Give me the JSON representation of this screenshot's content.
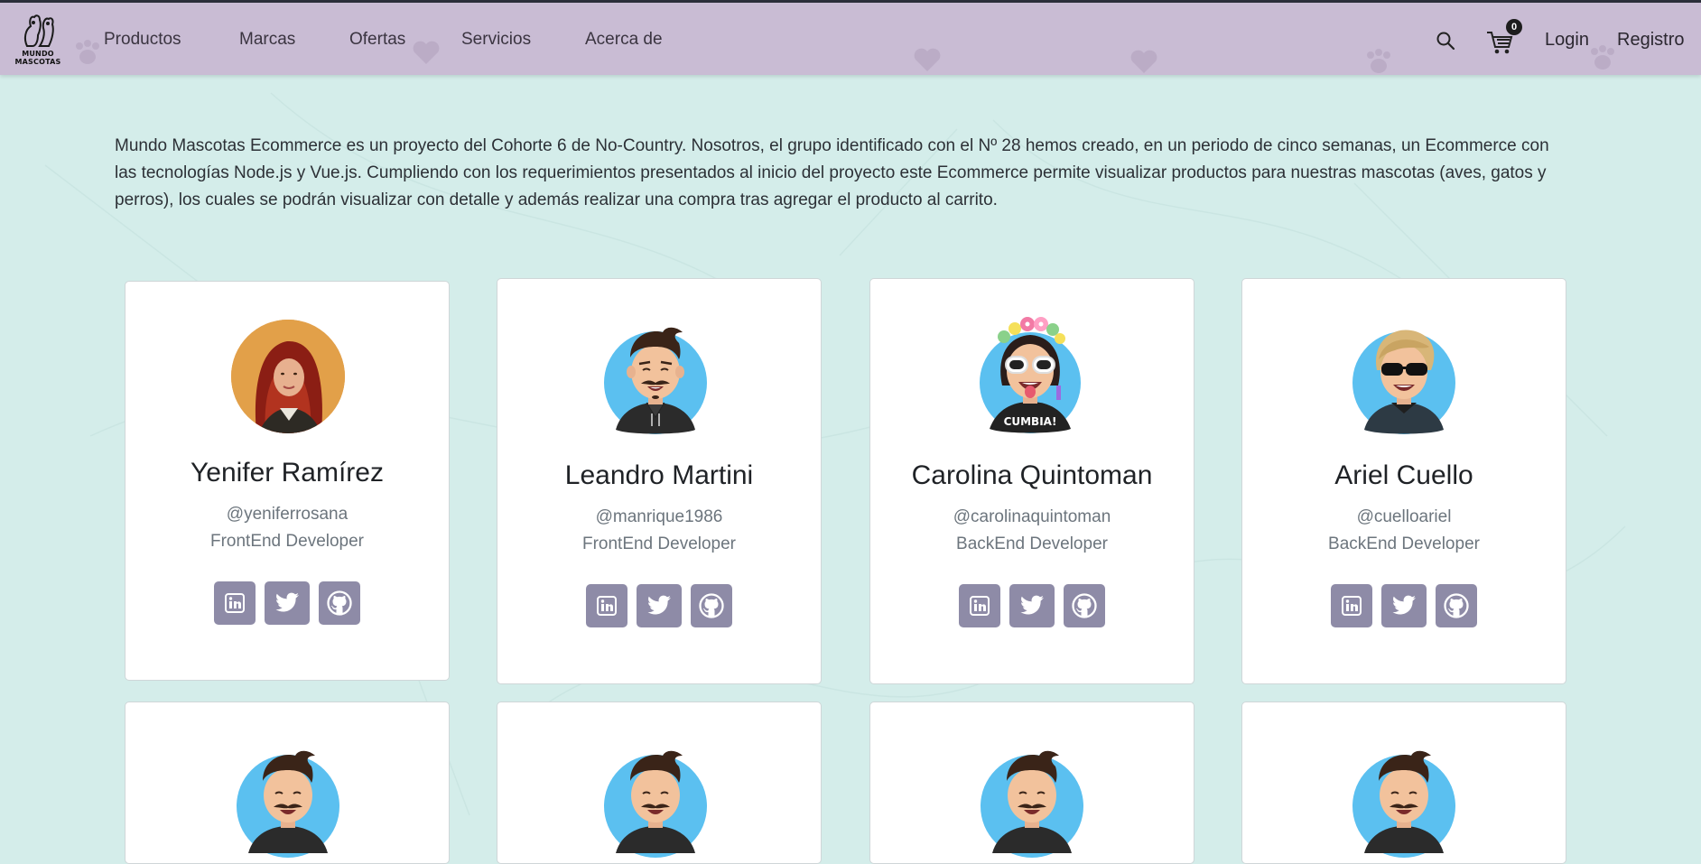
{
  "nav": {
    "logo_line1": "MUNDO",
    "logo_line2": "MASCOTAS",
    "links": [
      "Productos",
      "Marcas",
      "Ofertas",
      "Servicios",
      "Acerca de"
    ],
    "cart_count": "0",
    "login": "Login",
    "register": "Registro"
  },
  "about": {
    "text": "Mundo Mascotas Ecommerce es un proyecto del Cohorte 6 de No-Country. Nosotros, el grupo identificado con el Nº 28 hemos creado, en un periodo de cinco semanas, un Ecommerce con las tecnologías Node.js y Vue.js. Cumpliendo con los requerimientos presentados al inicio del proyecto este Ecommerce permite visualizar productos para nuestras mascotas (aves, gatos y perros), los cuales se podrán visualizar con detalle y además realizar una compra tras agregar el producto al carrito."
  },
  "team": [
    {
      "name": "Yenifer Ramírez",
      "handle": "@yeniferrosana",
      "role": "FrontEnd Developer",
      "avatar": "photo"
    },
    {
      "name": "Leandro Martini",
      "handle": "@manrique1986",
      "role": "FrontEnd Developer",
      "avatar": "cartoon-man"
    },
    {
      "name": "Carolina Quintoman",
      "handle": "@carolinaquintoman",
      "role": "BackEnd Developer",
      "avatar": "cartoon-flowers",
      "shirt_text": "CUMBIA!"
    },
    {
      "name": "Ariel Cuello",
      "handle": "@cuelloariel",
      "role": "BackEnd Developer",
      "avatar": "cartoon-sunglasses"
    }
  ],
  "icons": {
    "social": [
      "linkedin-icon",
      "twitter-icon",
      "github-icon"
    ],
    "search": "search-icon",
    "cart": "cart-icon"
  },
  "colors": {
    "navbar": "#c9bcd4",
    "page_bg": "#d4edea",
    "social_button": "#8e8ba7",
    "avatar_blue": "#5bc0f0"
  }
}
